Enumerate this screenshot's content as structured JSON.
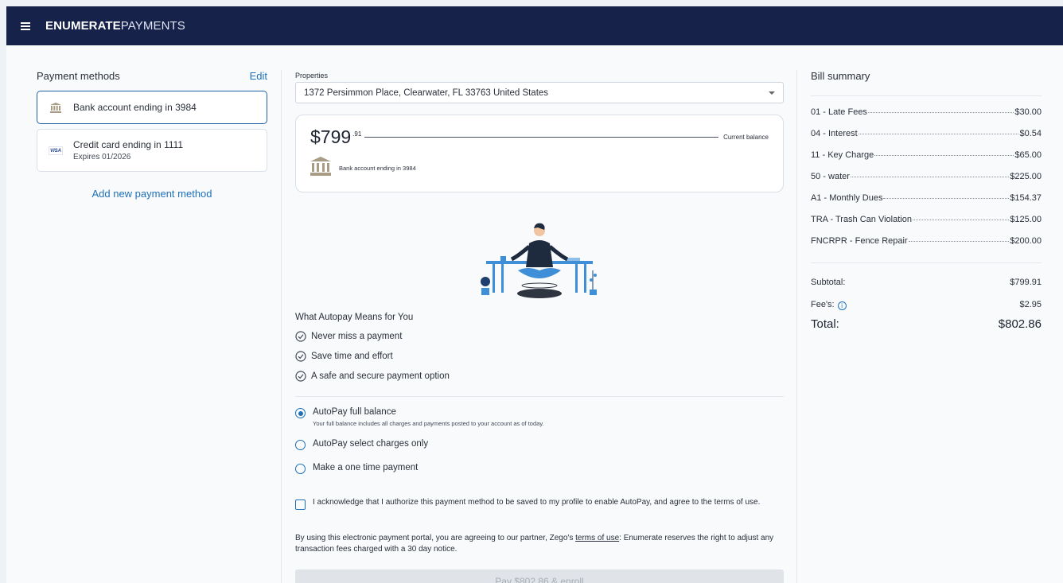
{
  "header": {
    "brand_bold": "ENUMERATE",
    "brand_light": "PAYMENTS",
    "menu_icon": "hamburger-menu-icon",
    "bar_color": "#17224a"
  },
  "payment_methods": {
    "title": "Payment methods",
    "edit_label": "Edit",
    "items": [
      {
        "label": "Bank account ending in 3984",
        "sub": "",
        "icon": "bank-icon",
        "selected": true
      },
      {
        "label": "Credit card ending in 1111",
        "sub": "Expires 01/2026",
        "icon": "visa-icon",
        "icon_text": "VISA",
        "selected": false
      }
    ],
    "add_label": "Add new payment method"
  },
  "properties": {
    "label": "Properties",
    "selected": "1372 Persimmon Place, Clearwater, FL 33763 United States"
  },
  "balance": {
    "amount": "$799",
    "cents": ".91",
    "label": "Current balance",
    "account": "Bank account ending in 3984"
  },
  "autopay": {
    "title": "What Autopay Means for You",
    "benefits": [
      "Never miss a payment",
      "Save time and effort",
      "A safe and secure payment option"
    ],
    "options": [
      {
        "label": "AutoPay full balance",
        "sub": "Your full balance includes all charges and payments posted to your account as of today.",
        "selected": true
      },
      {
        "label": "AutoPay select charges only",
        "sub": "",
        "selected": false
      },
      {
        "label": "Make a one time payment",
        "sub": "",
        "selected": false
      }
    ],
    "acknowledge": "I acknowledge that I authorize this payment method to be saved to my profile to enable AutoPay, and agree to the terms of use.",
    "terms_before": "By using this electronic payment portal, you are agreeing to our partner, Zego's ",
    "terms_link": "terms of use",
    "terms_after": ": Enumerate reserves the right to adjust any transaction fees charged with a 30 day notice.",
    "pay_button": "Pay $802.86 & enroll"
  },
  "bill_summary": {
    "title": "Bill summary",
    "items": [
      {
        "name": "01 - Late Fees",
        "amount": "$30.00"
      },
      {
        "name": "04 - Interest",
        "amount": "$0.54"
      },
      {
        "name": "11 - Key Charge",
        "amount": "$65.00"
      },
      {
        "name": "50 - water",
        "amount": "$225.00"
      },
      {
        "name": "A1 - Monthly Dues",
        "amount": "$154.37"
      },
      {
        "name": "TRA - Trash Can Violation",
        "amount": "$125.00"
      },
      {
        "name": "FNCRPR - Fence Repair",
        "amount": "$200.00"
      }
    ],
    "subtotal_label": "Subtotal:",
    "subtotal": "$799.91",
    "fees_label": "Fee's:",
    "fees": "$2.95",
    "total_label": "Total:",
    "total": "$802.86"
  },
  "colors": {
    "accent": "#1f6fb8",
    "disabled_button": "#e0e3e8"
  }
}
